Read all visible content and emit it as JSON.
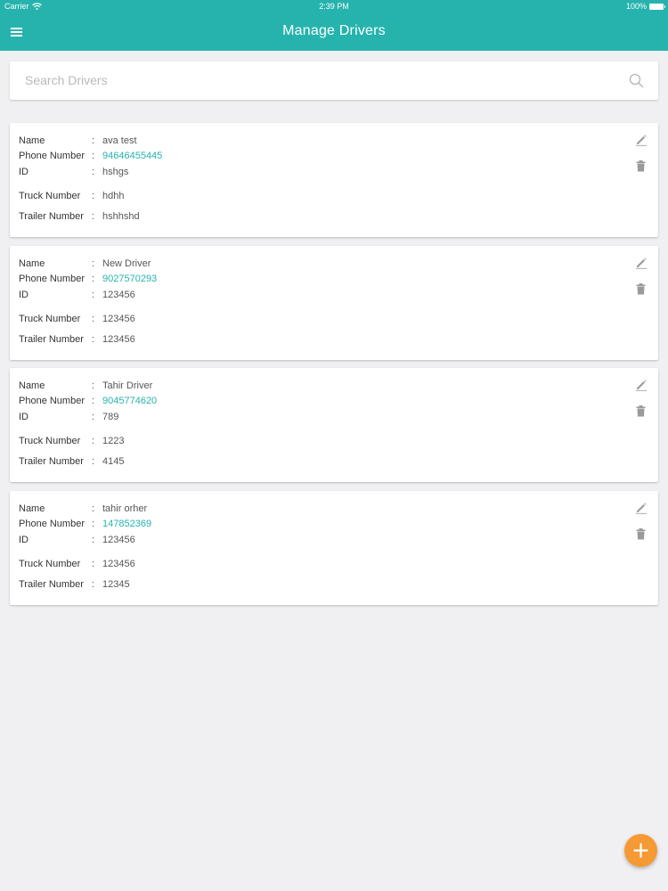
{
  "status_bar": {
    "carrier": "Carrier",
    "time": "2:39 PM",
    "battery": "100%"
  },
  "header": {
    "title": "Manage Drivers"
  },
  "search": {
    "placeholder": "Search Drivers",
    "value": ""
  },
  "labels": {
    "name": "Name",
    "phone": "Phone Number",
    "id": "ID",
    "truck": "Truck Number",
    "trailer": "Trailer Number",
    "separator": ":"
  },
  "drivers": [
    {
      "name": "ava test",
      "phone": "94646455445",
      "id": "hshgs",
      "truck": "hdhh",
      "trailer": "hshhshd"
    },
    {
      "name": "New Driver",
      "phone": "9027570293",
      "id": "123456",
      "truck": "123456",
      "trailer": "123456"
    },
    {
      "name": "Tahir Driver",
      "phone": "9045774620",
      "id": "789",
      "truck": "1223",
      "trailer": "4145"
    },
    {
      "name": "tahir orher",
      "phone": "147852369",
      "id": "123456",
      "truck": "123456",
      "trailer": "12345"
    }
  ],
  "icons": {
    "menu": "menu-icon",
    "search": "search-icon",
    "edit": "pencil-icon",
    "delete": "trash-icon",
    "add": "plus-icon"
  },
  "colors": {
    "header": "#26b3ad",
    "accent": "#26b3ad",
    "fab": "#f59a34",
    "background": "#f0f0f2"
  }
}
